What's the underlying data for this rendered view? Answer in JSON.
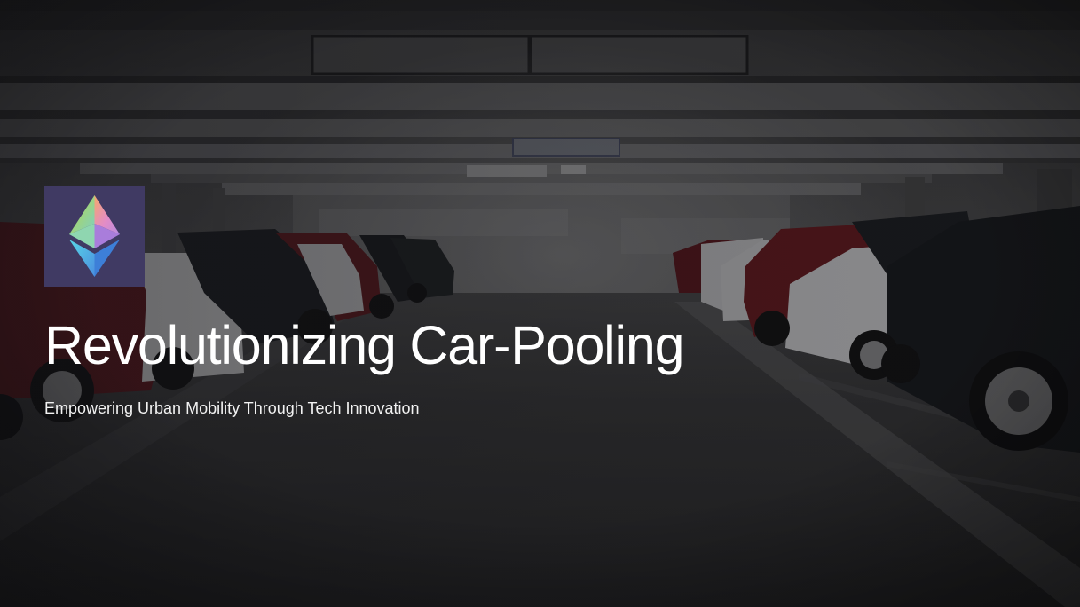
{
  "slide": {
    "title": "Revolutionizing Car-Pooling",
    "subtitle": "Empowering Urban Mobility Through Tech Innovation"
  },
  "background": {
    "scene": "parking-garage-photo",
    "tone": "dark"
  },
  "logo": {
    "icon": "ethereum-icon",
    "tile_color": "#403a63"
  },
  "colors": {
    "text": "#ffffff",
    "accent_red": "#7c1d22"
  }
}
